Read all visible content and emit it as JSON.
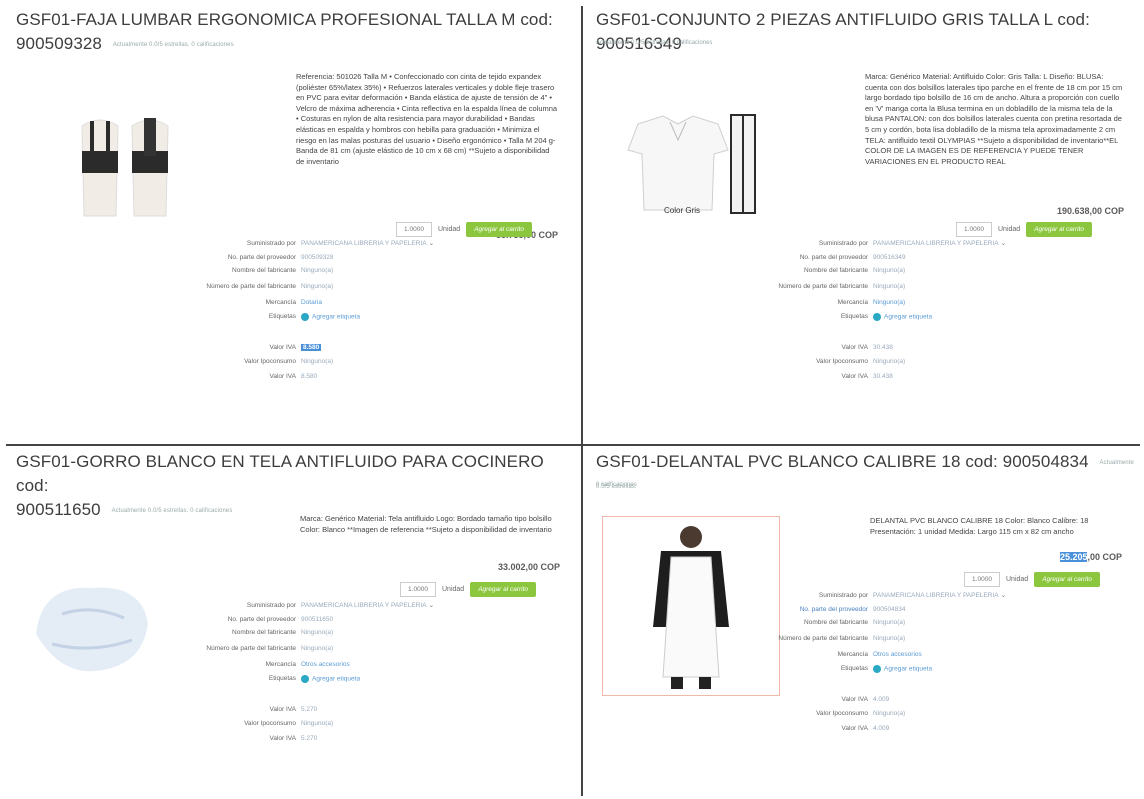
{
  "products": [
    {
      "title_line1": "GSF01-FAJA LUMBAR ERGONOMICA PROFESIONAL TALLA M cod:",
      "title_line2": "900509328",
      "rating": "Actualmente 0.0/5 estrellas. 0 calificaciones",
      "description": "Referencia: 501026 Talla M • Confeccionado con cinta de tejido expandex (poliéster 65%/latex 35%) • Refuerzos laterales verticales y doble fleje trasero en PVC para evitar deformación • Banda elástica de ajuste de tensión de 4\" • Velcro de máxima adherencia • Cinta reflectiva en la espalda línea de columna • Costuras en nylon de alta resistencia para mayor durabilidad • Bandas elásticas en espalda y hombros con hebilla para graduación • Minimiza el riesgo en las malas posturas del usuario • Diseño ergonómico • Talla M 204 g- Banda de 81 cm (ajuste elástico de 10 cm x 68 cm) **Sujeto a disponibilidad de inventario",
      "price": "53.738,00 COP",
      "qty": "1.0000",
      "unit": "Unidad",
      "cart": "Agregar al carrito",
      "supplier_label": "Suministrado por",
      "supplier": "PANAMERICANA LIBRERIA Y PAPELERIA",
      "part_label": "No. parte del proveedor",
      "part": "900509328",
      "maker_label": "Nombre del fabricante",
      "maker": "Ninguno(a)",
      "makerpart_label": "Número de parte del fabricante",
      "makerpart": "Ninguno(a)",
      "merch_label": "Mercancía",
      "merch": "Dotaria",
      "tags_label": "Etiquetas",
      "tags": "Agregar etiqueta",
      "iva_label": "Valor IVA",
      "iva": "8.580",
      "ipo_label": "Valor Ipoconsumo",
      "ipo": "Ninguno(a)",
      "iva2_label": "Valor IVA",
      "iva2": "8.580"
    },
    {
      "title_line1": "GSF01-CONJUNTO 2 PIEZAS ANTIFLUIDO GRIS TALLA L cod: 900516349",
      "rating": "Actualmente 0.0/5 estrellas. 0 calificaciones",
      "description": "Marca: Genérico Material: Antifluido Color: Gris Talla: L Diseño: BLUSA: cuenta con dos bolsillos laterales tipo parche en el frente de 18 cm por 15 cm largo bordado tipo bolsillo de 16 cm de ancho. Altura a proporción con cuello en 'V' manga corta la Blusa termina en un dobladillo de la misma tela de la blusa PANTALON: con dos bolsillos laterales cuenta con pretina resortada de 5 cm y cordón, bota lisa dobladillo de la misma tela aproximadamente 2 cm TELA: antifluido textil OLYMPIAS **Sujeto a disponibilidad de inventario**EL COLOR DE LA IMAGEN ES DE REFERENCIA Y PUEDE TENER VARIACIONES EN EL PRODUCTO REAL",
      "caption": "Color Gris",
      "price": "190.638,00 COP",
      "qty": "1.0000",
      "unit": "Unidad",
      "cart": "Agregar al carrito",
      "supplier_label": "Suministrado por",
      "supplier": "PANAMERICANA LIBRERIA Y PAPELERIA",
      "part_label": "No. parte del proveedor",
      "part": "900516349",
      "maker_label": "Nombre del fabricante",
      "maker": "Ninguno(a)",
      "makerpart_label": "Número de parte del fabricante",
      "makerpart": "Ninguno(a)",
      "merch_label": "Mercancía",
      "merch": "Ninguno(a)",
      "tags_label": "Etiquetas",
      "tags": "Agregar etiqueta",
      "iva_label": "Valor IVA",
      "iva": "30.438",
      "ipo_label": "Valor Ipoconsumo",
      "ipo": "Ninguno(a)",
      "iva2_label": "Valor IVA",
      "iva2": "30.438"
    },
    {
      "title_line1": "GSF01-GORRO BLANCO EN TELA ANTIFLUIDO PARA COCINERO cod:",
      "title_line2": "900511650",
      "rating": "Actualmente 0.0/5 estrellas. 0 calificaciones",
      "description": "Marca: Genérico Material: Tela antifluido Logo: Bordado tamaño tipo bolsillo Color: Blanco **Imagen de referencia **Sujeto a disponibilidad de inventario",
      "price": "33.002,00 COP",
      "qty": "1.0000",
      "unit": "Unidad",
      "cart": "Agregar al carrito",
      "supplier_label": "Suministrado por",
      "supplier": "PANAMERICANA LIBRERIA Y PAPELERIA",
      "part_label": "No. parte del proveedor",
      "part": "900511650",
      "maker_label": "Nombre del fabricante",
      "maker": "Ninguno(a)",
      "makerpart_label": "Número de parte del fabricante",
      "makerpart": "Ninguno(a)",
      "merch_label": "Mercancía",
      "merch": "Otros accesorios",
      "tags_label": "Etiquetas",
      "tags": "Agregar etiqueta",
      "iva_label": "Valor IVA",
      "iva": "5.270",
      "ipo_label": "Valor Ipoconsumo",
      "ipo": "Ninguno(a)",
      "iva2_label": "Valor IVA",
      "iva2": "5.270"
    },
    {
      "title_line1": "GSF01-DELANTAL PVC BLANCO CALIBRE 18 cod: 900504834",
      "rating": "Actualmente 0.0/5 estrellas.",
      "rating2": "0 calificaciones",
      "description": "DELANTAL PVC BLANCO CALIBRE 18 Color: Blanco Calibre: 18 Presentación: 1 unidad Medida: Largo 115 cm x 82 cm ancho",
      "price_hl": "25.205",
      "price_rest": ",00 COP",
      "qty": "1.0000",
      "unit": "Unidad",
      "cart": "Agregar al carrito",
      "supplier_label": "Suministrado por",
      "supplier": "PANAMERICANA LIBRERIA Y PAPELERIA",
      "part_label": "No. parte del proveedor",
      "part": "900504834",
      "maker_label": "Nombre del fabricante",
      "maker": "Ninguno(a)",
      "makerpart_label": "Número de parte del fabricante",
      "makerpart": "Ninguno(a)",
      "merch_label": "Mercancía",
      "merch": "Otros accesorios",
      "tags_label": "Etiquetas",
      "tags": "Agregar etiqueta",
      "iva_label": "Valor IVA",
      "iva": "4.009",
      "ipo_label": "Valor Ipoconsumo",
      "ipo": "Ninguno(a)",
      "iva2_label": "Valor IVA",
      "iva2": "4.009"
    }
  ],
  "colors": {
    "cart_green": "#8cc63f",
    "link_blue": "#5b9bd5",
    "highlight_blue": "#4a90d9",
    "tag_teal": "#2aa8c4"
  },
  "icons": {
    "tag": "tag-icon",
    "chevron": "chevron-down-icon"
  }
}
